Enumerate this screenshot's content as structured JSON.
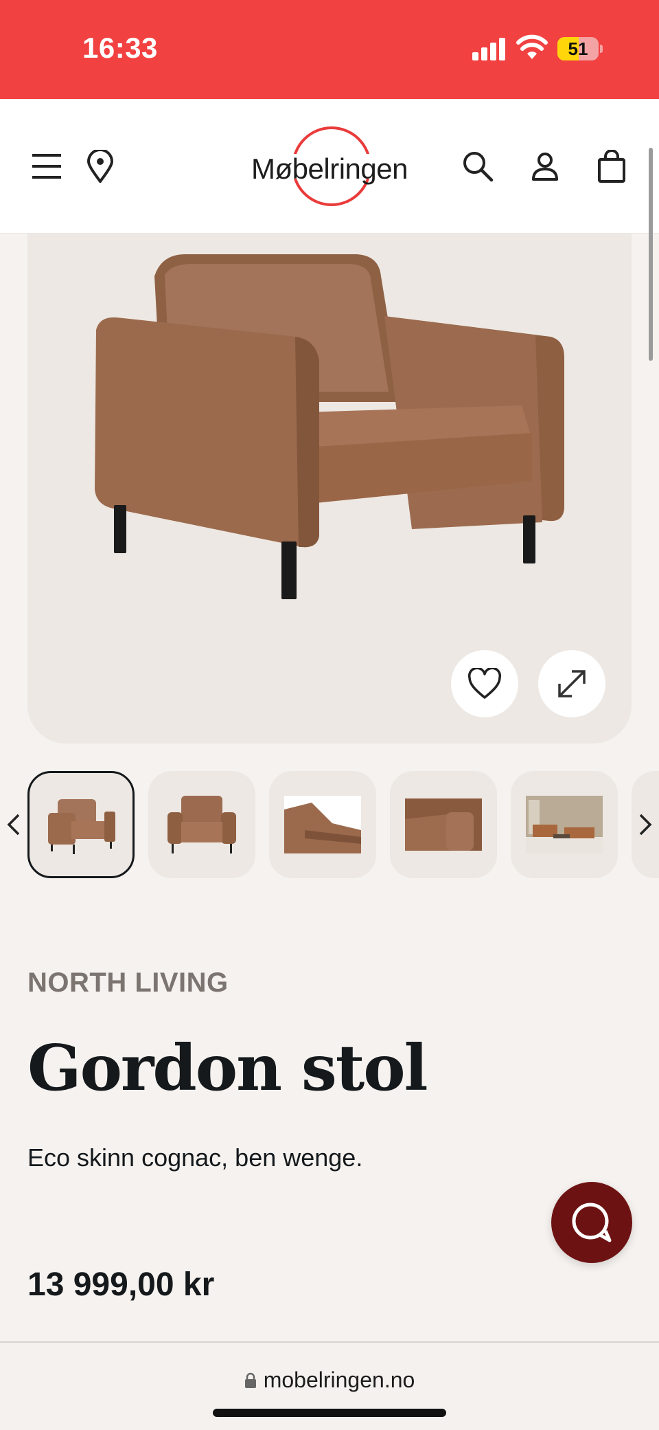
{
  "status_bar": {
    "time": "16:33",
    "battery": "51",
    "battery_level": 0.51
  },
  "header": {
    "logo_text": "Møbelringen"
  },
  "product": {
    "brand": "NORTH LIVING",
    "title": "Gordon stol",
    "description": "Eco skinn cognac, ben wenge.",
    "price": "13 999,00 kr"
  },
  "browser": {
    "url": "mobelringen.no"
  },
  "colors": {
    "status_bar": "#f24141",
    "chat_button": "#6d1212",
    "logo_ring": "#ea3b3b"
  }
}
